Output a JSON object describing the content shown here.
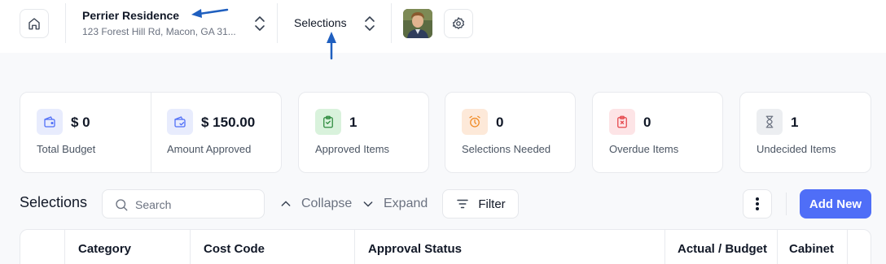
{
  "header": {
    "project_name": "Perrier Residence",
    "project_address": "123 Forest Hill Rd, Macon, GA 31...",
    "view_name": "Selections",
    "icons": {
      "home": "home-icon",
      "switcher": "chevron-up-down-icon",
      "settings": "gear-icon",
      "avatar": "user-avatar"
    }
  },
  "stats": [
    {
      "value": "$ 0",
      "label": "Total Budget",
      "icon": "wallet-icon",
      "bg": "#e8ecfd",
      "color": "#4f6ef7"
    },
    {
      "value": "$ 150.00",
      "label": "Amount Approved",
      "icon": "wallet-check-icon",
      "bg": "#e8ecfd",
      "color": "#4f6ef7"
    },
    {
      "value": "1",
      "label": "Approved Items",
      "icon": "clipboard-check-icon",
      "bg": "#d9f2dc",
      "color": "#2e8b3e"
    },
    {
      "value": "0",
      "label": "Selections Needed",
      "icon": "alarm-clock-icon",
      "bg": "#fde9d9",
      "color": "#f08a24"
    },
    {
      "value": "0",
      "label": "Overdue Items",
      "icon": "clipboard-x-icon",
      "bg": "#fde4e6",
      "color": "#e5484d"
    },
    {
      "value": "1",
      "label": "Undecided Items",
      "icon": "hourglass-icon",
      "bg": "#eceef1",
      "color": "#6b7280"
    }
  ],
  "toolbar": {
    "title": "Selections",
    "search_placeholder": "Search",
    "collapse_label": "Collapse",
    "expand_label": "Expand",
    "filter_label": "Filter",
    "add_label": "Add New"
  },
  "table": {
    "columns": [
      "Category",
      "Cost Code",
      "Approval Status",
      "Actual / Budget",
      "Cabinet"
    ]
  },
  "colors": {
    "accent": "#4f6ef7",
    "annotation_arrow": "#1f5fbf"
  }
}
